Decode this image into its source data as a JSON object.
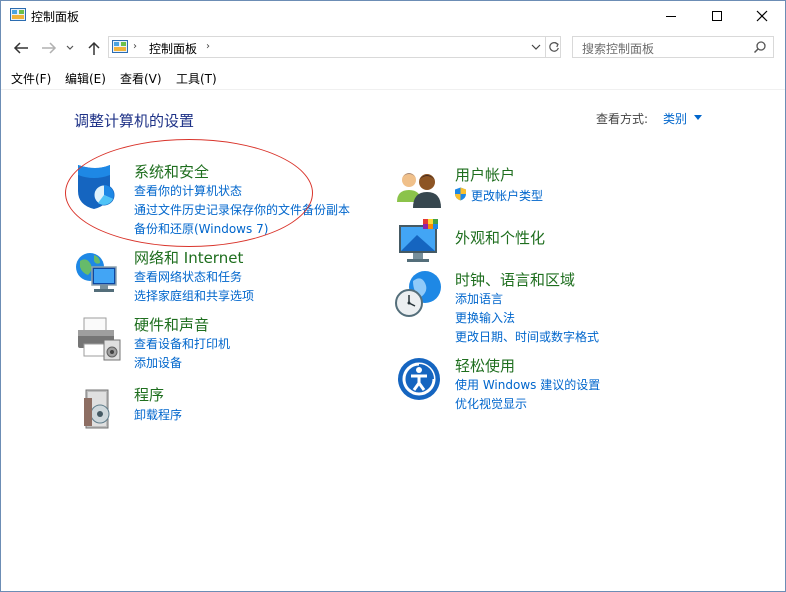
{
  "window": {
    "title": "控制面板"
  },
  "address": {
    "path": "控制面板",
    "search_placeholder": "搜索控制面板"
  },
  "menu": [
    "文件(F)",
    "编辑(E)",
    "查看(V)",
    "工具(T)"
  ],
  "content": {
    "title": "调整计算机的设置",
    "view_by_label": "查看方式:",
    "view_by_value": "类别"
  },
  "categories": {
    "security": {
      "title": "系统和安全",
      "links": [
        "查看你的计算机状态",
        "通过文件历史记录保存你的文件备份副本",
        "备份和还原(Windows 7)"
      ]
    },
    "network": {
      "title": "网络和 Internet",
      "links": [
        "查看网络状态和任务",
        "选择家庭组和共享选项"
      ]
    },
    "hardware": {
      "title": "硬件和声音",
      "links": [
        "查看设备和打印机",
        "添加设备"
      ]
    },
    "programs": {
      "title": "程序",
      "links": [
        "卸载程序"
      ]
    },
    "users": {
      "title": "用户帐户",
      "links": [
        "更改帐户类型"
      ]
    },
    "appearance": {
      "title": "外观和个性化",
      "links": []
    },
    "clock": {
      "title": "时钟、语言和区域",
      "links": [
        "添加语言",
        "更换输入法",
        "更改日期、时间或数字格式"
      ]
    },
    "ease": {
      "title": "轻松使用",
      "links": [
        "使用 Windows 建议的设置",
        "优化视觉显示"
      ]
    }
  },
  "colors": {
    "category_title": "#1e6e1e",
    "link": "#0066cc",
    "heading": "#1e3287",
    "annotation": "#d9342b"
  }
}
